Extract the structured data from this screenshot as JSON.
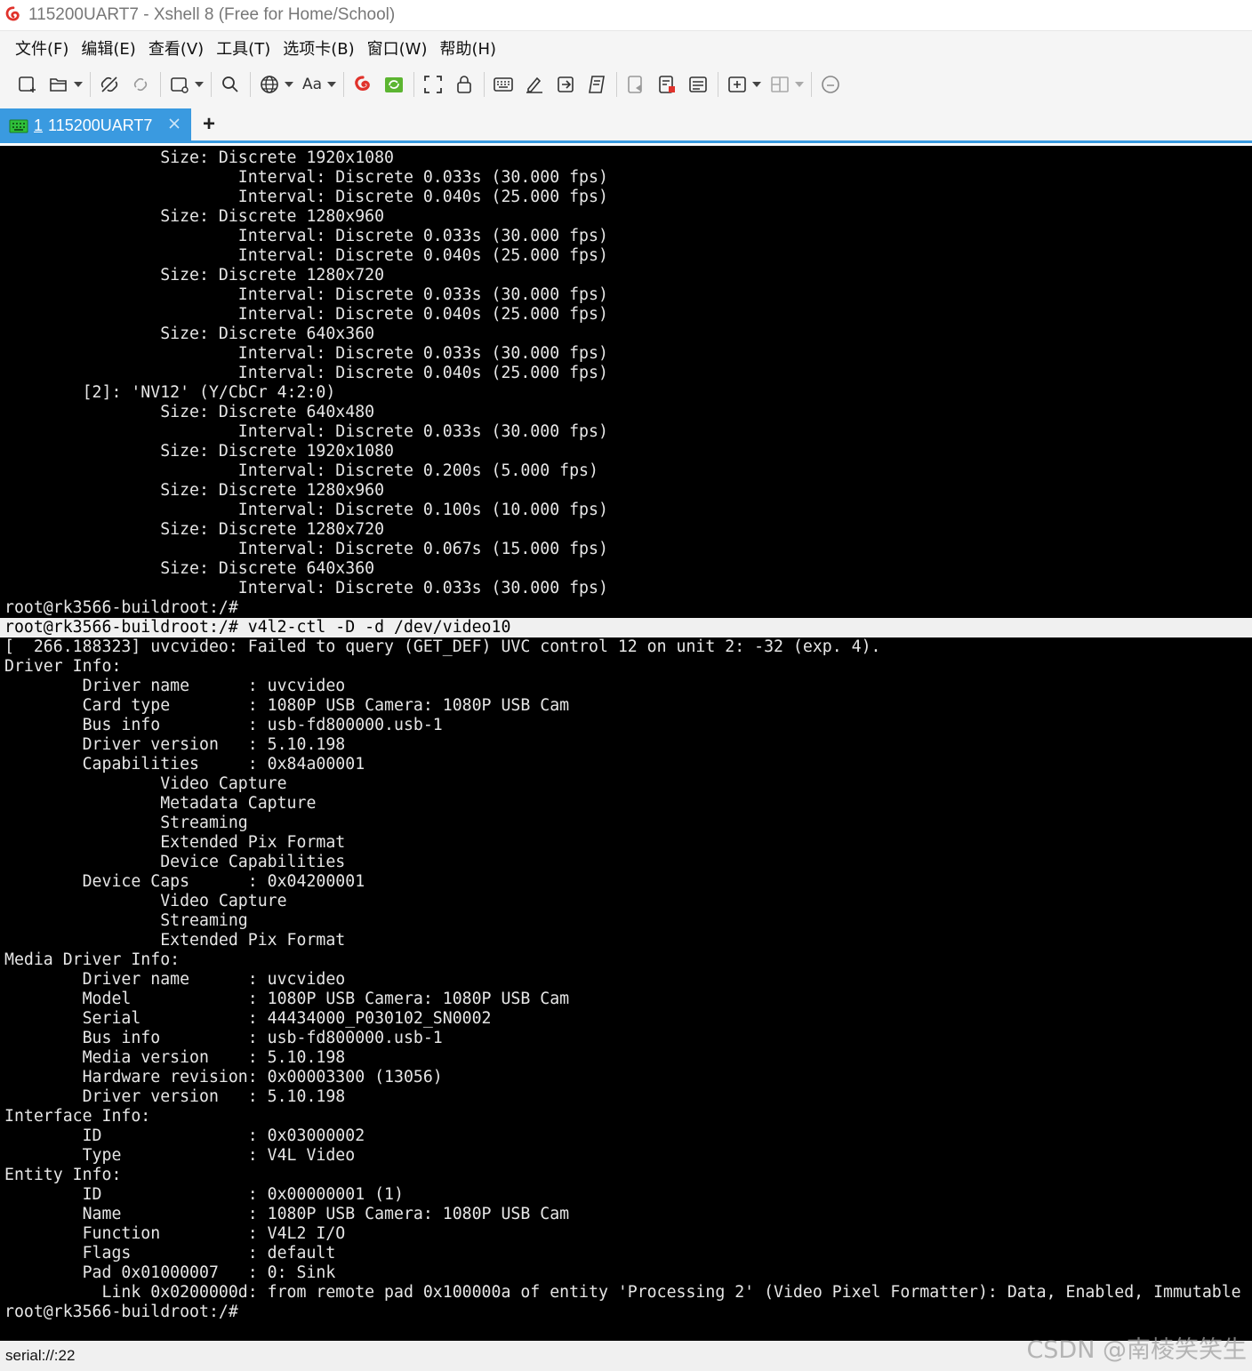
{
  "window": {
    "title": "115200UART7 - Xshell 8 (Free for Home/School)"
  },
  "menu": [
    {
      "label": "文件(F)"
    },
    {
      "label": "编辑(E)"
    },
    {
      "label": "查看(V)"
    },
    {
      "label": "工具(T)"
    },
    {
      "label": "选项卡(B)"
    },
    {
      "label": "窗口(W)"
    },
    {
      "label": "帮助(H)"
    }
  ],
  "toolbar": {
    "font_label": "Aa",
    "icons": [
      "new-session-icon",
      "open-folder-icon",
      "disconnect-icon",
      "reconnect-icon",
      "new-window-icon",
      "find-icon",
      "globe-icon",
      "font-icon",
      "xshell-icon",
      "xftp-icon",
      "fullscreen-icon",
      "lock-icon",
      "keyboard-icon",
      "compose-icon",
      "send-icon",
      "script-icon",
      "log-icon",
      "record-icon",
      "notes-icon",
      "add-pane-icon",
      "layout-icon",
      "chat-icon"
    ]
  },
  "tab": {
    "number": "1",
    "label": "115200UART7",
    "new_tab_symbol": "+"
  },
  "terminal": {
    "lines": [
      "                Size: Discrete 1920x1080",
      "                        Interval: Discrete 0.033s (30.000 fps)",
      "                        Interval: Discrete 0.040s (25.000 fps)",
      "                Size: Discrete 1280x960",
      "                        Interval: Discrete 0.033s (30.000 fps)",
      "                        Interval: Discrete 0.040s (25.000 fps)",
      "                Size: Discrete 1280x720",
      "                        Interval: Discrete 0.033s (30.000 fps)",
      "                        Interval: Discrete 0.040s (25.000 fps)",
      "                Size: Discrete 640x360",
      "                        Interval: Discrete 0.033s (30.000 fps)",
      "                        Interval: Discrete 0.040s (25.000 fps)",
      "        [2]: 'NV12' (Y/CbCr 4:2:0)",
      "                Size: Discrete 640x480",
      "                        Interval: Discrete 0.033s (30.000 fps)",
      "                Size: Discrete 1920x1080",
      "                        Interval: Discrete 0.200s (5.000 fps)",
      "                Size: Discrete 1280x960",
      "                        Interval: Discrete 0.100s (10.000 fps)",
      "                Size: Discrete 1280x720",
      "                        Interval: Discrete 0.067s (15.000 fps)",
      "                Size: Discrete 640x360",
      "                        Interval: Discrete 0.033s (30.000 fps)",
      "root@rk3566-buildroot:/#",
      "root@rk3566-buildroot:/# v4l2-ctl -D -d /dev/video10",
      "[  266.188323] uvcvideo: Failed to query (GET_DEF) UVC control 12 on unit 2: -32 (exp. 4).",
      "Driver Info:",
      "        Driver name      : uvcvideo",
      "        Card type        : 1080P USB Camera: 1080P USB Cam",
      "        Bus info         : usb-fd800000.usb-1",
      "        Driver version   : 5.10.198",
      "        Capabilities     : 0x84a00001",
      "                Video Capture",
      "                Metadata Capture",
      "                Streaming",
      "                Extended Pix Format",
      "                Device Capabilities",
      "        Device Caps      : 0x04200001",
      "                Video Capture",
      "                Streaming",
      "                Extended Pix Format",
      "Media Driver Info:",
      "        Driver name      : uvcvideo",
      "        Model            : 1080P USB Camera: 1080P USB Cam",
      "        Serial           : 44434000_P030102_SN0002",
      "        Bus info         : usb-fd800000.usb-1",
      "        Media version    : 5.10.198",
      "        Hardware revision: 0x00003300 (13056)",
      "        Driver version   : 5.10.198",
      "Interface Info:",
      "        ID               : 0x03000002",
      "        Type             : V4L Video",
      "Entity Info:",
      "        ID               : 0x00000001 (1)",
      "        Name             : 1080P USB Camera: 1080P USB Cam",
      "        Function         : V4L2 I/O",
      "        Flags            : default",
      "        Pad 0x01000007   : 0: Sink",
      "          Link 0x0200000d: from remote pad 0x100000a of entity 'Processing 2' (Video Pixel Formatter): Data, Enabled, Immutable",
      "root@rk3566-buildroot:/#"
    ],
    "selected_line_index": 24
  },
  "status": {
    "connection": "serial://:22"
  },
  "watermark": "CSDN @南棱笑笑生"
}
